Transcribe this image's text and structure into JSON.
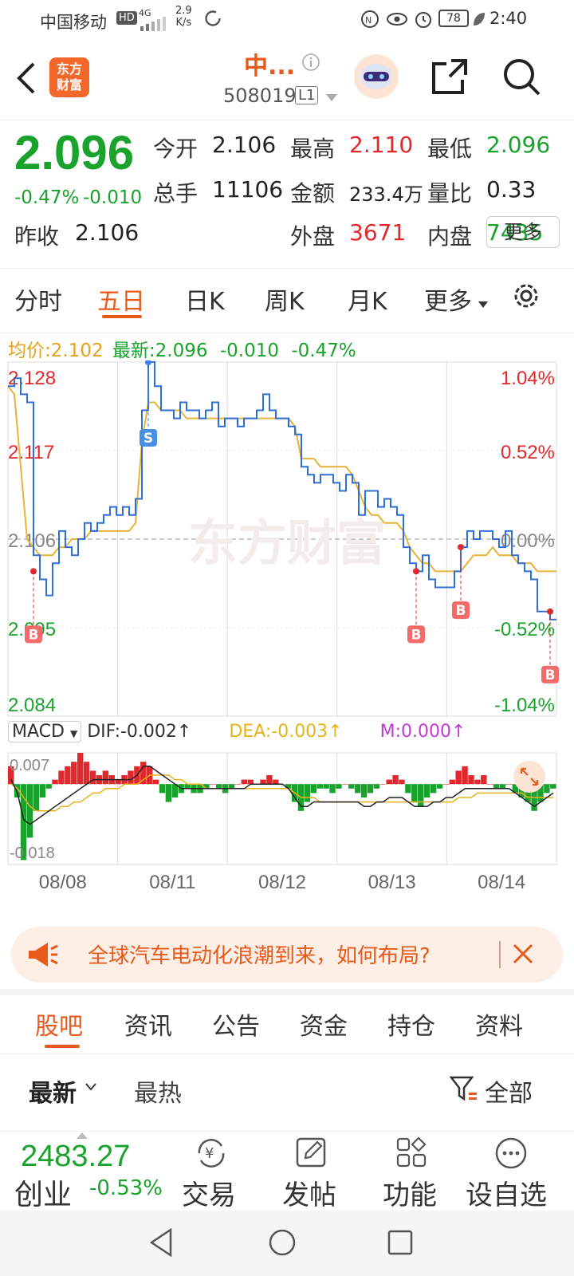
{
  "status": {
    "carrier": "中国移动",
    "hd": "HD",
    "net": "4G",
    "speed_top": "2.9",
    "speed_bottom": "K/s",
    "battery": "78",
    "time": "2:40"
  },
  "header": {
    "logo_line1": "东方",
    "logo_line2": "财富",
    "title": "中...",
    "code": "508019",
    "level": "L1"
  },
  "quote": {
    "price": "2.096",
    "change_pct": "-0.47%",
    "change": "-0.010",
    "rows": [
      [
        {
          "label": "今开",
          "value": "2.106",
          "color": "normal"
        },
        {
          "label": "最高",
          "value": "2.110",
          "color": "red"
        },
        {
          "label": "最低",
          "value": "2.096",
          "color": "green"
        }
      ],
      [
        {
          "label": "总手",
          "value": "11106",
          "color": "normal"
        },
        {
          "label": "金额",
          "value": "233.4万",
          "color": "normal"
        },
        {
          "label": "量比",
          "value": "0.33",
          "color": "normal"
        }
      ],
      [
        {
          "label": "昨收",
          "value": "2.106",
          "color": "normal"
        },
        {
          "label": "外盘",
          "value": "3671",
          "color": "red"
        },
        {
          "label": "内盘",
          "value": "7435",
          "color": "green"
        }
      ]
    ],
    "more": "更多"
  },
  "tabs": [
    "分时",
    "五日",
    "日K",
    "周K",
    "月K",
    "更多"
  ],
  "active_tab": "五日",
  "legend": {
    "avg_label": "均价:",
    "avg_value": "2.102",
    "latest_label": "最新:",
    "latest_value": "2.096",
    "latest_change": "-0.010",
    "latest_pct": "-0.47%"
  },
  "macd": {
    "selector": "MACD",
    "dif": "DIF:-0.002",
    "dea": "DEA:-0.003",
    "m": "M:0.000",
    "top_label": "0.007",
    "bottom_label": "-0.018"
  },
  "banner": {
    "text": "全球汽车电动化浪潮到来，如何布局?"
  },
  "subtabs": [
    "股吧",
    "资讯",
    "公告",
    "资金",
    "持仓",
    "资料"
  ],
  "sort": {
    "latest": "最新",
    "hot": "最热",
    "filter": "全部"
  },
  "bottom": {
    "index_value": "2483.27",
    "index_name": "创业",
    "index_pct": "-0.53%",
    "items": [
      "交易",
      "发帖",
      "功能",
      "设自选"
    ]
  },
  "watermark": "东方财富",
  "colors": {
    "up": "#e0292d",
    "down": "#1aa32c",
    "price_line": "#2f6fd6",
    "avg_line": "#e6b33a",
    "accent": "#e85a1c"
  },
  "chart_data": {
    "type": "line",
    "x_days": [
      "08/08",
      "08/11",
      "08/12",
      "08/13",
      "08/14"
    ],
    "y_ticks_left": [
      "2.128",
      "2.117",
      "2.106",
      "2.095",
      "2.084"
    ],
    "y_ticks_right": [
      "1.04%",
      "0.52%",
      "0.00%",
      "-0.52%",
      "-1.04%"
    ],
    "ylim": [
      2.084,
      2.128
    ],
    "reference": 2.106,
    "series": [
      {
        "values": [
          2.125,
          2.126,
          2.124,
          2.123,
          2.104,
          2.101,
          2.099,
          2.103,
          2.107,
          2.105,
          2.104,
          2.106,
          2.108,
          2.107,
          2.108,
          2.109,
          2.11,
          2.109,
          2.11,
          2.109,
          2.111,
          2.122,
          2.128,
          2.125,
          2.122,
          2.122,
          2.121,
          2.123,
          2.122,
          2.122,
          2.121,
          2.122,
          2.123,
          2.12,
          2.121,
          2.121,
          2.12,
          2.121,
          2.121,
          2.122,
          2.124,
          2.122,
          2.121,
          2.121,
          2.12,
          2.119,
          2.115,
          2.114,
          2.113,
          2.114,
          2.114,
          2.113,
          2.112,
          2.114,
          2.113,
          2.109,
          2.112,
          2.112,
          2.11,
          2.111,
          2.11,
          2.109,
          2.105,
          2.103,
          2.102,
          2.104,
          2.101,
          2.1,
          2.1,
          2.1,
          2.102,
          2.105,
          2.107,
          2.106,
          2.107,
          2.107,
          2.106,
          2.105,
          2.107,
          2.104,
          2.103,
          2.102,
          2.101,
          2.097,
          2.097,
          2.096,
          2.096
        ]
      },
      {
        "values": [
          2.125,
          2.124,
          2.115,
          2.106,
          2.105,
          2.104,
          2.104,
          2.104,
          2.105,
          2.105,
          2.106,
          2.106,
          2.106,
          2.107,
          2.107,
          2.107,
          2.107,
          2.107,
          2.107,
          2.107,
          2.108,
          2.118,
          2.123,
          2.123,
          2.122,
          2.122,
          2.122,
          2.122,
          2.121,
          2.121,
          2.121,
          2.121,
          2.121,
          2.121,
          2.121,
          2.121,
          2.121,
          2.121,
          2.121,
          2.121,
          2.121,
          2.121,
          2.121,
          2.121,
          2.121,
          2.12,
          2.116,
          2.116,
          2.116,
          2.115,
          2.115,
          2.115,
          2.115,
          2.115,
          2.114,
          2.112,
          2.11,
          2.109,
          2.109,
          2.108,
          2.108,
          2.108,
          2.107,
          2.105,
          2.104,
          2.103,
          2.103,
          2.102,
          2.102,
          2.102,
          2.102,
          2.102,
          2.103,
          2.104,
          2.104,
          2.104,
          2.105,
          2.104,
          2.104,
          2.104,
          2.103,
          2.103,
          2.103,
          2.102,
          2.102,
          2.102,
          2.102
        ]
      }
    ],
    "markers": [
      {
        "type": "B",
        "i": 4,
        "price": 2.102
      },
      {
        "type": "S",
        "i": 22,
        "price": 2.128
      },
      {
        "type": "B",
        "i": 64,
        "price": 2.102
      },
      {
        "type": "B",
        "i": 71,
        "price": 2.105
      },
      {
        "type": "B",
        "i": 85,
        "price": 2.097
      }
    ],
    "macd": {
      "ylim": [
        -0.018,
        0.007
      ],
      "bars": [
        0.004,
        -0.003,
        -0.017,
        -0.012,
        -0.006,
        -0.003,
        -0.001,
        0.001,
        0.003,
        0.004,
        0.005,
        0.007,
        0.005,
        0.003,
        0.002,
        0.003,
        0.002,
        0.001,
        0.002,
        0.003,
        0.004,
        0.005,
        0.004,
        0.001,
        -0.002,
        -0.004,
        -0.003,
        -0.002,
        -0.001,
        -0.002,
        -0.002,
        -0.001,
        0.0,
        -0.001,
        -0.002,
        -0.001,
        0.0,
        0.001,
        0.001,
        0.0,
        0.001,
        0.002,
        0.001,
        0.0,
        -0.001,
        -0.004,
        -0.006,
        -0.004,
        -0.002,
        -0.001,
        -0.001,
        -0.002,
        -0.001,
        0.0,
        -0.001,
        -0.002,
        -0.003,
        -0.002,
        -0.001,
        0.0,
        0.001,
        0.002,
        0.001,
        -0.002,
        -0.004,
        -0.005,
        -0.003,
        -0.002,
        -0.001,
        0.0,
        0.001,
        0.003,
        0.004,
        0.002,
        0.001,
        0.002,
        0.0,
        -0.001,
        -0.001,
        0.0,
        -0.002,
        -0.003,
        -0.004,
        -0.006,
        -0.004,
        -0.002,
        -0.001
      ],
      "dif": [
        0.001,
        -0.002,
        -0.008,
        -0.009,
        -0.008,
        -0.007,
        -0.006,
        -0.005,
        -0.004,
        -0.003,
        -0.002,
        -0.001,
        0.0,
        0.001,
        0.001,
        0.001,
        0.001,
        0.001,
        0.001,
        0.001,
        0.002,
        0.004,
        0.004,
        0.003,
        0.002,
        0.001,
        0.0,
        -0.001,
        -0.001,
        -0.001,
        -0.001,
        -0.001,
        -0.001,
        -0.001,
        -0.001,
        -0.001,
        -0.001,
        -0.001,
        0.0,
        0.0,
        0.0,
        0.0,
        0.0,
        0.0,
        -0.001,
        -0.003,
        -0.005,
        -0.005,
        -0.004,
        -0.004,
        -0.004,
        -0.004,
        -0.004,
        -0.004,
        -0.004,
        -0.004,
        -0.005,
        -0.005,
        -0.004,
        -0.004,
        -0.003,
        -0.003,
        -0.003,
        -0.004,
        -0.005,
        -0.005,
        -0.005,
        -0.004,
        -0.004,
        -0.003,
        -0.003,
        -0.002,
        -0.001,
        -0.001,
        -0.001,
        -0.001,
        -0.001,
        -0.001,
        -0.001,
        -0.001,
        -0.002,
        -0.003,
        -0.004,
        -0.005,
        -0.004,
        -0.003,
        -0.002
      ],
      "dea": [
        0.0,
        -0.001,
        -0.003,
        -0.005,
        -0.006,
        -0.006,
        -0.006,
        -0.006,
        -0.005,
        -0.005,
        -0.004,
        -0.004,
        -0.003,
        -0.002,
        -0.002,
        -0.001,
        -0.001,
        -0.001,
        0.0,
        0.0,
        0.0,
        0.001,
        0.002,
        0.002,
        0.002,
        0.002,
        0.001,
        0.001,
        0.0,
        0.0,
        0.0,
        -0.001,
        -0.001,
        -0.001,
        -0.001,
        -0.001,
        -0.001,
        -0.001,
        -0.001,
        -0.001,
        -0.001,
        -0.001,
        -0.001,
        -0.001,
        -0.001,
        -0.002,
        -0.003,
        -0.003,
        -0.003,
        -0.004,
        -0.004,
        -0.004,
        -0.004,
        -0.004,
        -0.004,
        -0.004,
        -0.004,
        -0.004,
        -0.004,
        -0.004,
        -0.004,
        -0.004,
        -0.004,
        -0.004,
        -0.004,
        -0.004,
        -0.004,
        -0.004,
        -0.004,
        -0.004,
        -0.004,
        -0.003,
        -0.003,
        -0.003,
        -0.002,
        -0.002,
        -0.002,
        -0.002,
        -0.002,
        -0.002,
        -0.002,
        -0.002,
        -0.003,
        -0.003,
        -0.003,
        -0.003,
        -0.003
      ]
    }
  }
}
